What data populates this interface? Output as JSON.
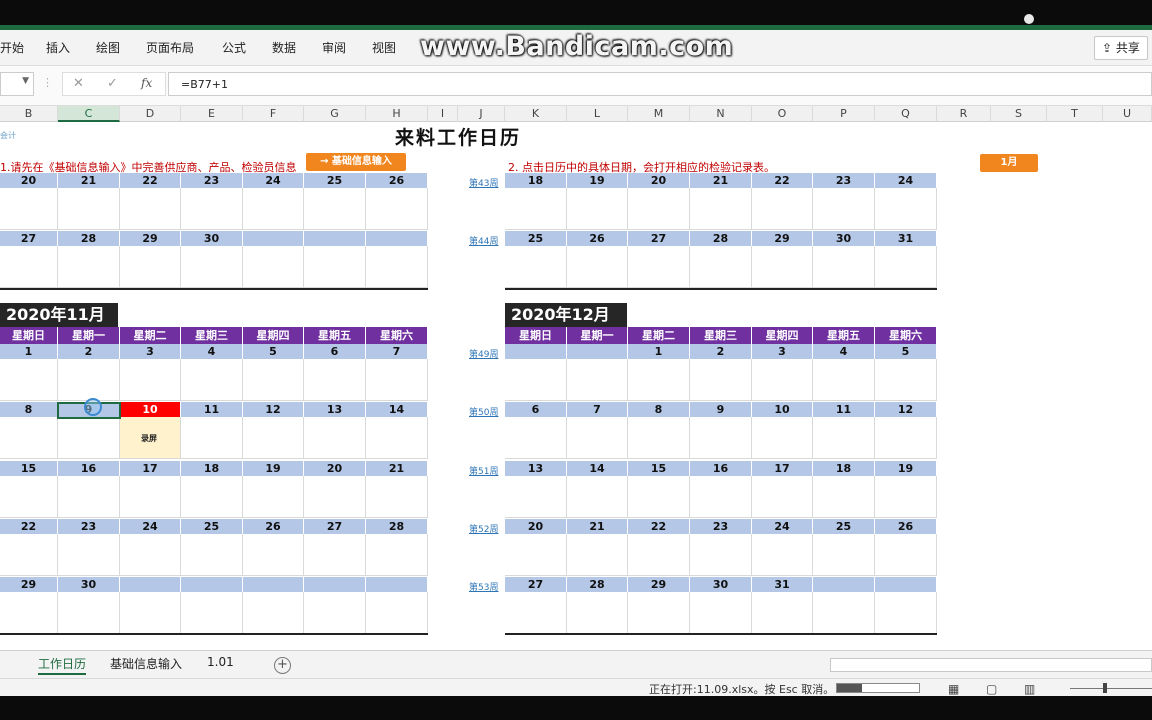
{
  "watermark": "www.Bandicam.com",
  "ribbon": {
    "tabs": [
      "开始",
      "插入",
      "绘图",
      "页面布局",
      "公式",
      "数据",
      "审阅",
      "视图"
    ],
    "share_label": "共享"
  },
  "formula_bar": {
    "formula": "=B77+1",
    "fx_label": "fx"
  },
  "columns": [
    "B",
    "C",
    "D",
    "E",
    "F",
    "G",
    "H",
    "I",
    "J",
    "K",
    "L",
    "M",
    "N",
    "O",
    "P",
    "Q",
    "R",
    "S",
    "T",
    "U"
  ],
  "sheet": {
    "title": "来料工作日历",
    "tiny_note": "会计",
    "note1": "1.请先在《基础信息输入》中完善供应商、产品、检验员信息",
    "button_basic": "→ 基础信息输入",
    "note2": "2. 点击日历中的具体日期，会打开相应的检验记录表。",
    "month_button": "1月"
  },
  "weekdays": [
    "星期日",
    "星期一",
    "星期二",
    "星期三",
    "星期四",
    "星期五",
    "星期六"
  ],
  "october_partial": {
    "rows": [
      [
        "20",
        "21",
        "22",
        "23",
        "24",
        "25",
        "26"
      ],
      [
        "27",
        "28",
        "29",
        "30",
        "",
        "",
        ""
      ]
    ]
  },
  "november_label_partial": {
    "weeks": [
      "第43周",
      "第44周"
    ],
    "rows": [
      [
        "18",
        "19",
        "20",
        "21",
        "22",
        "23",
        "24"
      ],
      [
        "25",
        "26",
        "27",
        "28",
        "29",
        "30",
        "31"
      ]
    ]
  },
  "nov": {
    "title": "2020年11月",
    "rows": [
      [
        "1",
        "2",
        "3",
        "4",
        "5",
        "6",
        "7"
      ],
      [
        "8",
        "9",
        "10",
        "11",
        "12",
        "13",
        "14"
      ],
      [
        "15",
        "16",
        "17",
        "18",
        "19",
        "20",
        "21"
      ],
      [
        "22",
        "23",
        "24",
        "25",
        "26",
        "27",
        "28"
      ],
      [
        "29",
        "30",
        "",
        "",
        "",
        "",
        ""
      ]
    ],
    "today_label": "录屏"
  },
  "dec": {
    "title": "2020年12月",
    "weeks": [
      "第49周",
      "第50周",
      "第51周",
      "第52周",
      "第53周"
    ],
    "rows": [
      [
        "",
        "",
        "1",
        "2",
        "3",
        "4",
        "5"
      ],
      [
        "6",
        "7",
        "8",
        "9",
        "10",
        "11",
        "12"
      ],
      [
        "13",
        "14",
        "15",
        "16",
        "17",
        "18",
        "19"
      ],
      [
        "20",
        "21",
        "22",
        "23",
        "24",
        "25",
        "26"
      ],
      [
        "27",
        "28",
        "29",
        "30",
        "31",
        "",
        ""
      ]
    ]
  },
  "sheet_tabs": [
    "工作日历",
    "基础信息输入",
    "1.01"
  ],
  "status": {
    "text": "正在打开:11.09.xlsx。按 Esc 取消。",
    "progress": 0.3
  },
  "colors": {
    "excel_green": "#1f6b41",
    "weekday_purple": "#7030a0",
    "date_blue": "#b4c7e7",
    "today_red": "#ff0000",
    "accent_orange": "#f2861e"
  }
}
